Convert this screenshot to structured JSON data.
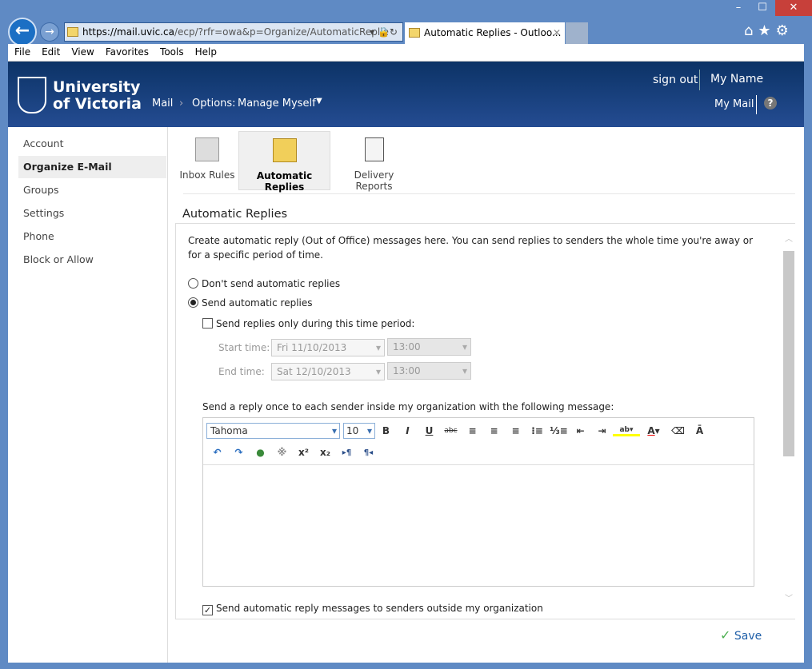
{
  "browser": {
    "url_host": "https://mail.uvic.ca",
    "url_path": "/ecp/?rfr=owa&p=Organize/AutomaticReplie",
    "tab_title": "Automatic Replies - Outloo...",
    "menu": [
      "File",
      "Edit",
      "View",
      "Favorites",
      "Tools",
      "Help"
    ]
  },
  "header": {
    "university_line1": "University",
    "university_line2": "of Victoria",
    "breadcrumb_mail": "Mail",
    "breadcrumb_options": "Options:",
    "breadcrumb_manage": "Manage Myself",
    "sign_out": "sign out",
    "user_name": "My Name",
    "my_mail": "My Mail",
    "help": "?"
  },
  "sidebar": {
    "items": [
      "Account",
      "Organize E-Mail",
      "Groups",
      "Settings",
      "Phone",
      "Block or Allow"
    ]
  },
  "toolbar": {
    "inbox_rules": "Inbox Rules",
    "automatic_replies": "Automatic Replies",
    "delivery_reports": "Delivery Reports"
  },
  "main": {
    "title": "Automatic Replies",
    "intro": "Create automatic reply (Out of Office) messages here. You can send replies to senders the whole time you're away or for a specific period of time.",
    "radio_dont": "Don't send automatic replies",
    "radio_send": "Send automatic replies",
    "time_period": "Send replies only during this time period:",
    "start_label": "Start time:",
    "start_date": "Fri 11/10/2013",
    "start_time": "13:00",
    "end_label": "End time:",
    "end_date": "Sat 12/10/2013",
    "end_time": "13:00",
    "inside_label": "Send a reply once to each sender inside my organization with the following message:",
    "font": "Tahoma",
    "size": "10",
    "outside_label": "Send automatic reply messages to senders outside my organization",
    "save": "Save"
  }
}
